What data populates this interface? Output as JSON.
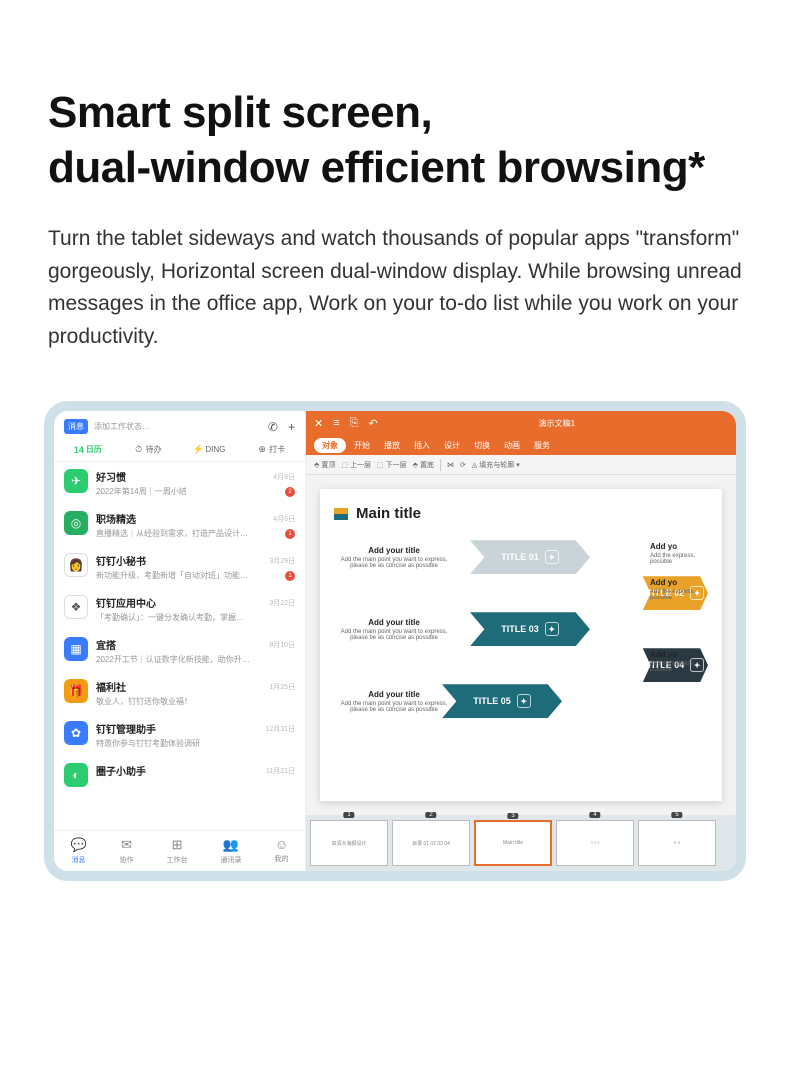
{
  "hero": {
    "title_line1": "Smart split screen,",
    "title_line2": "dual-window efficient browsing*",
    "body": "Turn the tablet sideways and watch thousands of popular apps \"transform\" gorgeously, Horizontal screen dual-window display. While browsing unread messages in the office app, Work on your to-do list while you work on your productivity."
  },
  "left_app": {
    "badge": "消息",
    "status": "添加工作状态…",
    "top_icons": {
      "phone": "✆",
      "plus": "+"
    },
    "tabs": [
      {
        "icon": "14",
        "label": "日历"
      },
      {
        "icon": "⏱",
        "label": "待办"
      },
      {
        "icon": "⚡",
        "label": "DING"
      },
      {
        "icon": "⊕",
        "label": "打卡"
      }
    ],
    "items": [
      {
        "color": "#2ecc71",
        "icon": "✈",
        "name": "好习惯",
        "sub": "2022年第14周｜一周小结",
        "time": "4月8日",
        "badge": "2"
      },
      {
        "color": "#27ae60",
        "icon": "◎",
        "name": "职场精选",
        "sub": "直播精选｜从经验到需求，打造产品设计思路",
        "time": "4月6日",
        "badge": "1"
      },
      {
        "color": "#fff",
        "icon": "👩",
        "name": "钉钉小秘书",
        "sub": "新功能升级，考勤新增「自动对班」功能，打…",
        "time": "3月29日",
        "badge": "1"
      },
      {
        "color": "#fff",
        "icon": "❖",
        "name": "钉钉应用中心",
        "sub": "「考勤确认」：一键分发确认考勤，掌握确认状…",
        "time": "3月22日",
        "badge": ""
      },
      {
        "color": "#3a7cff",
        "icon": "▦",
        "name": "宜搭",
        "sub": "2022开工节｜认证数字化新技能，助你升职加薪>>",
        "time": "8月10日",
        "badge": ""
      },
      {
        "color": "#f39c12",
        "icon": "🎁",
        "name": "福利社",
        "sub": "敬业人，钉钉送你敬业福！",
        "time": "1月25日",
        "badge": ""
      },
      {
        "color": "#3a7cff",
        "icon": "✿",
        "name": "钉钉管理助手",
        "sub": "特邀你参与钉钉考勤体验调研",
        "time": "12月31日",
        "badge": ""
      },
      {
        "color": "#2ecc71",
        "icon": "◐",
        "name": "圈子小助手",
        "sub": "",
        "time": "11月21日",
        "badge": ""
      }
    ],
    "nav": [
      {
        "icon": "💬",
        "label": "消息",
        "active": true
      },
      {
        "icon": "✉",
        "label": "协作",
        "active": false
      },
      {
        "icon": "⊞",
        "label": "工作台",
        "active": false
      },
      {
        "icon": "👥",
        "label": "通讯录",
        "active": false
      },
      {
        "icon": "☺",
        "label": "我的",
        "active": false
      }
    ]
  },
  "right_app": {
    "title": "演示文稿1",
    "titlebar_icons": [
      "✕",
      "≡",
      "⎘",
      "↶"
    ],
    "menu": [
      "对象",
      "开始",
      "播放",
      "插入",
      "设计",
      "切换",
      "动画",
      "服务"
    ],
    "toolbar": [
      {
        "icon": "⬘",
        "label": "置顶"
      },
      {
        "icon": "⬚",
        "label": "上一层"
      },
      {
        "icon": "⬚",
        "label": "下一层"
      },
      {
        "icon": "⬘",
        "label": "置底"
      },
      {
        "icon": "⋈",
        "label": ""
      },
      {
        "icon": "⟳",
        "label": ""
      },
      {
        "icon": "◬",
        "label": "填充与轮廓 ▾"
      }
    ],
    "slide": {
      "title": "Main title",
      "row_title": "Add your title",
      "row_sub": "Add the main point you want to express, please be as concise as possible",
      "side_title": "Add yo",
      "side_sub": "Add the express, possible",
      "arrows": [
        {
          "label": "TITLE 01",
          "color": "#c9d4d8"
        },
        {
          "label": "TITLE 02",
          "color": "#e9a227"
        },
        {
          "label": "TITLE 03",
          "color": "#1e6b7a"
        },
        {
          "label": "TITLE 04",
          "color": "#2b3a42"
        },
        {
          "label": "TITLE 05",
          "color": "#1e6b7a"
        }
      ]
    },
    "thumbs": [
      {
        "num": "1",
        "label": "高清大海报设计"
      },
      {
        "num": "2",
        "label": "目录 01 02 03 04"
      },
      {
        "num": "3",
        "label": "Main title"
      },
      {
        "num": "4",
        "label": "○○○"
      },
      {
        "num": "5",
        "label": "◐◑"
      }
    ]
  }
}
